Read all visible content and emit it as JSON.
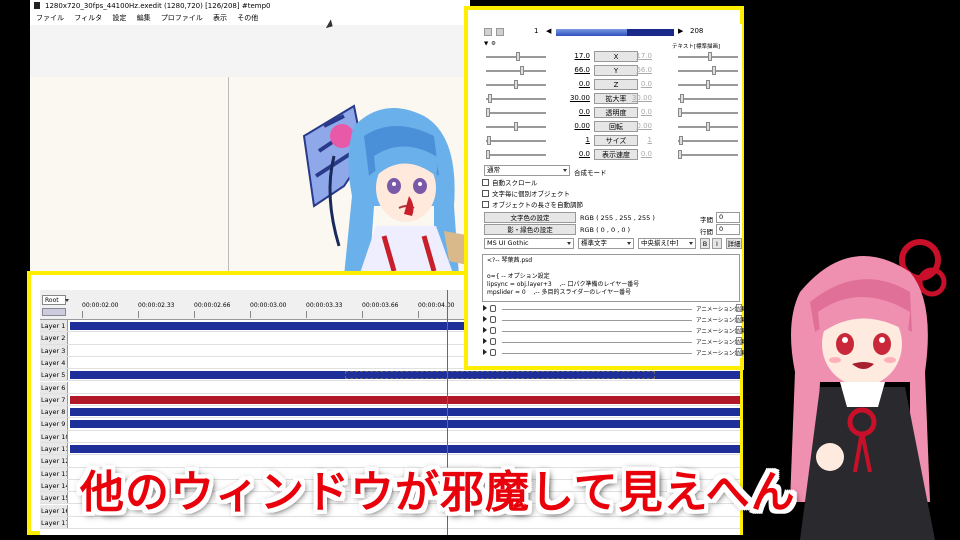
{
  "window": {
    "title": "1280x720_30fps_44100Hz.exedit (1280,720)  [126/208]  #temp0",
    "menu": [
      "ファイル",
      "フィルタ",
      "設定",
      "編集",
      "プロファイル",
      "表示",
      "その他"
    ]
  },
  "timeline": {
    "root_label": "Root",
    "times": [
      "00:00:02.00",
      "00:00:02.33",
      "00:00:02.66",
      "00:00:03.00",
      "00:00:03.33",
      "00:00:03.66",
      "00:00:04.00"
    ],
    "layers": [
      "Layer 1",
      "Layer 2",
      "Layer 3",
      "Layer 4",
      "Layer 5",
      "Layer 6",
      "Layer 7",
      "Layer 8",
      "Layer 9",
      "Layer 10",
      "Layer 11",
      "Layer 12",
      "Layer 13",
      "Layer 14",
      "Layer 15",
      "Layer 16",
      "Layer 17"
    ],
    "colors": {
      "blue_clip": "#1e2f9a",
      "red_clip": "#b0182a",
      "playhead": "#e53333",
      "highlight": "#ffee00"
    }
  },
  "settings": {
    "frame_start": "1",
    "frame_prev": "◀",
    "frame_next": "▶",
    "frame_end": "208",
    "sub_label": "テキスト[標準描画]",
    "params": [
      {
        "label": "X",
        "left": "17.0",
        "right": "17.0"
      },
      {
        "label": "Y",
        "left": "66.0",
        "right": "66.0"
      },
      {
        "label": "Z",
        "left": "0.0",
        "right": "0.0"
      },
      {
        "label": "拡大率",
        "left": "30.00",
        "right": "30.00"
      },
      {
        "label": "透明度",
        "left": "0.0",
        "right": "0.0"
      },
      {
        "label": "回転",
        "left": "0.00",
        "right": "0.00"
      },
      {
        "label": "サイズ",
        "left": "1",
        "right": "1"
      },
      {
        "label": "表示速度",
        "left": "0.0",
        "right": "0.0"
      }
    ],
    "blend_mode": "通常",
    "blend_label": "合成モード",
    "checks": [
      "自動スクロール",
      "文字毎に個別オブジェクト",
      "オブジェクトの長さを自動調節"
    ],
    "text_color_button": "文字色の設定",
    "text_color_value": "RGB ( 255 , 255 , 255 )",
    "shadow_color_button": "影・縁色の設定",
    "shadow_color_value": "RGB ( 0 , 0 , 0 )",
    "char_spacing_label": "字間",
    "char_spacing_value": "0",
    "line_spacing_label": "行間",
    "line_spacing_value": "0",
    "font": "MS UI Gothic",
    "style": "標準文字",
    "align": "中央揃え[中]",
    "bold": "B",
    "italic": "I",
    "detail": "詳細",
    "text_content": "<?-- 琴葉茜.psd\n\no={ -- オプション設定\nlipsync = obj.layer+3    ,-- 口パク準備のレイヤー番号\nmpslider = 0    ,-- 多目的スライダーのレイヤー番号",
    "anim_label": "アニメーション効果"
  },
  "caption": "他のウィンドウが邪魔して見えへん"
}
